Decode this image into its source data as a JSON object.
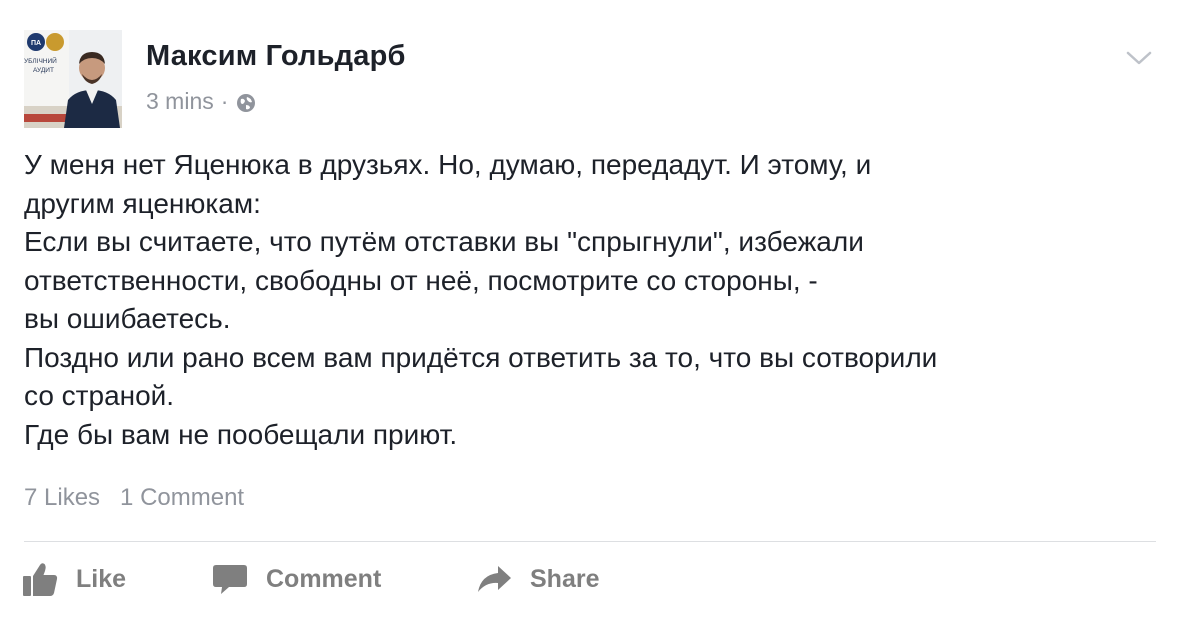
{
  "post": {
    "author": "Максим Гольдарб",
    "time": "3 mins",
    "separator": "·",
    "privacy_icon": "globe-icon",
    "menu_icon": "chevron-down-icon",
    "avatar": {
      "badge_text": "ПА",
      "caption_line1": "УБЛІЧНИЙ",
      "caption_line2": "АУДИТ"
    },
    "text_lines": [
      "У меня нет Яценюка в друзьях. Но, думаю, передадут. И этому, и",
      "другим яценюкам:",
      "Если вы считаете, что путём отставки вы \"спрыгнули\", избежали",
      "ответственности, свободны от неё, посмотрите со стороны, -",
      "вы ошибаетесь.",
      "Поздно или рано всем вам придётся ответить за то, что вы сотворили",
      "со страной.",
      "Где бы вам не пообещали приют."
    ],
    "likes": "7 Likes",
    "comments": "1 Comment"
  },
  "actions": {
    "like": {
      "label": "Like",
      "icon": "thumbs-up-icon"
    },
    "comment": {
      "label": "Comment",
      "icon": "speech-bubble-icon"
    },
    "share": {
      "label": "Share",
      "icon": "share-arrow-icon"
    }
  },
  "colors": {
    "text": "#1d2129",
    "secondary": "#90949c",
    "action": "#7f7f7f",
    "divider": "#dddfe2"
  }
}
